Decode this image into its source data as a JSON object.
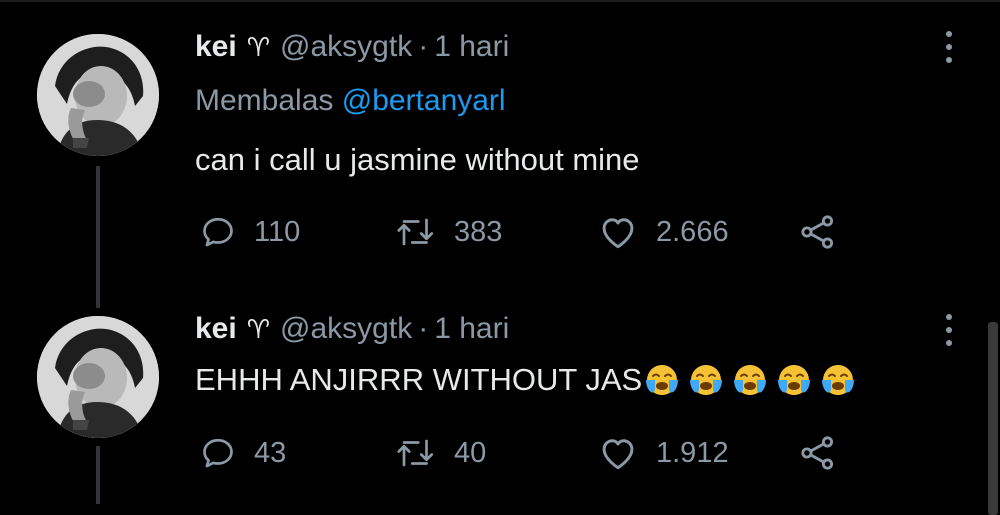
{
  "tweets": [
    {
      "name": "kei",
      "symbol": "♈",
      "handle": "@aksygtk",
      "separator": "·",
      "time": "1 hari",
      "replying_label": "Membalas",
      "replying_to": "@bertanyarl",
      "text": "can i call u jasmine without mine",
      "emojis": [],
      "replies": "110",
      "retweets": "383",
      "likes": "2.666"
    },
    {
      "name": "kei",
      "symbol": "♈",
      "handle": "@aksygtk",
      "separator": "·",
      "time": "1 hari",
      "text": "EHHH ANJIRRR WITHOUT JAS",
      "emojis": [
        "loudly-crying-face",
        "loudly-crying-face",
        "loudly-crying-face",
        "loudly-crying-face",
        "loudly-crying-face"
      ],
      "replies": "43",
      "retweets": "40",
      "likes": "1.912"
    }
  ],
  "icons": {
    "reply": "speech-bubble-icon",
    "retweet": "retweet-arrows-icon",
    "like": "heart-outline-icon",
    "share": "share-nodes-icon",
    "more": "vertical-ellipsis-icon"
  },
  "colors": {
    "background": "#000000",
    "text_primary": "#e7e9ea",
    "text_secondary": "#8b98a5",
    "mention": "#1d9bf0"
  }
}
